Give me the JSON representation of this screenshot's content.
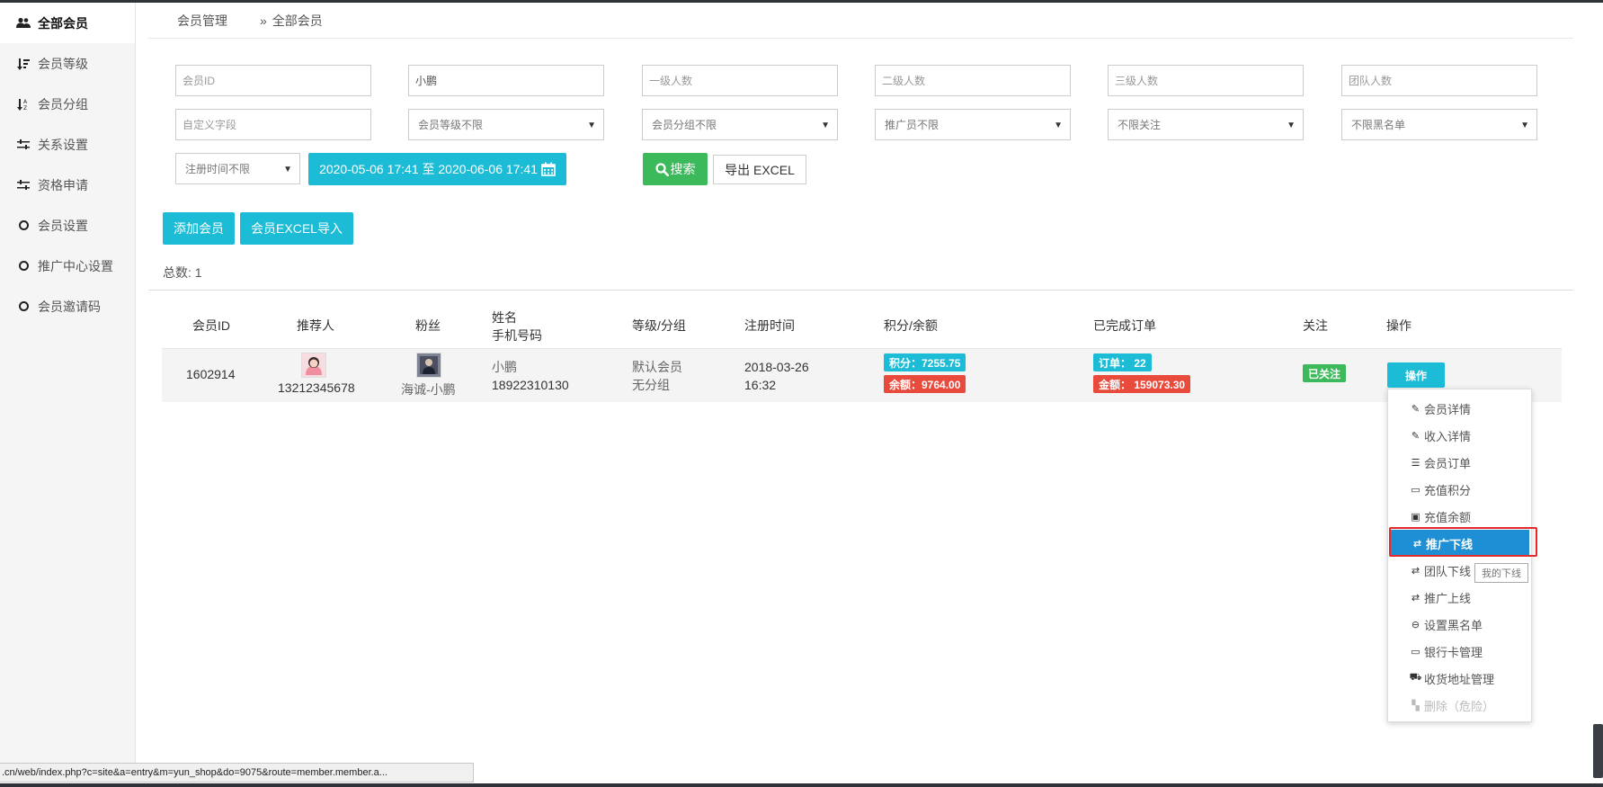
{
  "sidebar": {
    "items": [
      {
        "label": "全部会员",
        "icon": "users-icon"
      },
      {
        "label": "会员等级",
        "icon": "sort-amount-icon"
      },
      {
        "label": "会员分组",
        "icon": "sort-alpha-icon"
      },
      {
        "label": "关系设置",
        "icon": "sliders-icon"
      },
      {
        "label": "资格申请",
        "icon": "sliders-icon"
      },
      {
        "label": "会员设置",
        "icon": "circle-icon"
      },
      {
        "label": "推广中心设置",
        "icon": "circle-icon"
      },
      {
        "label": "会员邀请码",
        "icon": "circle-icon"
      }
    ]
  },
  "breadcrumb": {
    "parent": "会员管理",
    "separator": "»",
    "current": "全部会员"
  },
  "filters": {
    "member_id": {
      "placeholder": "会员ID",
      "value": ""
    },
    "name": {
      "placeholder": "",
      "value": "小鹏"
    },
    "level1_count": {
      "placeholder": "一级人数"
    },
    "level2_count": {
      "placeholder": "二级人数"
    },
    "level3_count": {
      "placeholder": "三级人数"
    },
    "team_count": {
      "placeholder": "团队人数"
    },
    "custom_field": {
      "placeholder": "自定义字段"
    },
    "member_level": "会员等级不限",
    "member_group": "会员分组不限",
    "promoter": "推广员不限",
    "follow": "不限关注",
    "blacklist": "不限黑名单",
    "register_time": "注册时间不限",
    "date_range": "2020-05-06 17:41 至 2020-06-06 17:41",
    "search_label": "搜索",
    "export_label": "导出 EXCEL"
  },
  "actions": {
    "add_member": "添加会员",
    "import_excel": "会员EXCEL导入"
  },
  "total": "总数:  1",
  "table": {
    "headers": {
      "member_id": "会员ID",
      "referrer": "推荐人",
      "fans": "粉丝",
      "name": "姓名",
      "phone": "手机号码",
      "level_group": "等级/分组",
      "register_time": "注册时间",
      "points_balance": "积分/余额",
      "completed_orders": "已完成订单",
      "follow": "关注",
      "operation": "操作"
    },
    "rows": [
      {
        "member_id": "1602914",
        "referrer": "13212345678",
        "fans_name": "海诚-小鹏",
        "name": "小鹏",
        "phone": "18922310130",
        "level": "默认会员",
        "group": "无分组",
        "register_date": "2018-03-26",
        "register_clock": "16:32",
        "points": "积分：7255.75",
        "balance": "余额：9764.00",
        "orders": "订单： 22",
        "amount": "金额： 159073.30",
        "follow_status": "已关注",
        "op_label": "操作"
      }
    ]
  },
  "op_menu": {
    "items": [
      {
        "label": "会员详情",
        "icon": "edit-icon"
      },
      {
        "label": "收入详情",
        "icon": "edit-icon"
      },
      {
        "label": "会员订单",
        "icon": "list-icon"
      },
      {
        "label": "充值积分",
        "icon": "credit-card-icon"
      },
      {
        "label": "充值余额",
        "icon": "money-icon"
      },
      {
        "label": "推广下线",
        "icon": "exchange-icon"
      },
      {
        "label": "团队下线",
        "icon": "exchange-icon"
      },
      {
        "label": "推广上线",
        "icon": "exchange-icon"
      },
      {
        "label": "设置黑名单",
        "icon": "minus-circle-icon"
      },
      {
        "label": "银行卡管理",
        "icon": "credit-card-icon"
      },
      {
        "label": "收货地址管理",
        "icon": "truck-icon"
      },
      {
        "label": "删除（危险）",
        "icon": "delete-icon"
      }
    ],
    "highlighted_index": 5,
    "tooltip": "我的下线"
  },
  "status_url": ".cn/web/index.php?c=site&a=entry&m=yun_shop&do=9075&route=member.member.a...",
  "colors": {
    "accent": "#1cbcd6",
    "success": "#3cb95b",
    "danger": "#e84b3c",
    "highlight": "#1e8fd5",
    "outline": "#e32b2b"
  }
}
